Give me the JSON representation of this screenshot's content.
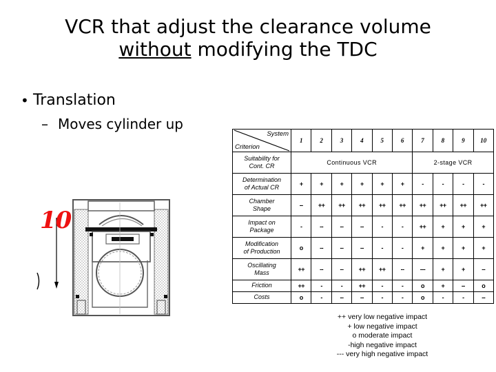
{
  "slide": {
    "title_line1": "VCR that adjust the clearance volume",
    "title_line2_underlined": "without",
    "title_line2_rest": " modifying the TDC"
  },
  "bullets": {
    "level1": "Translation",
    "level2": "Moves cylinder up"
  },
  "figure": {
    "label": "10",
    "caption_icon": "piston-cylinder-drawing"
  },
  "table": {
    "corner": {
      "top_right": "System",
      "bottom_left": "Criterion"
    },
    "columns": [
      "1",
      "2",
      "3",
      "4",
      "5",
      "6",
      "7",
      "8",
      "9",
      "10"
    ],
    "suitability": {
      "label_line1": "Suitability for",
      "label_line2": "Cont. CR",
      "groups": [
        {
          "name": "Continuous VCR",
          "span": 6
        },
        {
          "name": "2-stage VCR",
          "span": 4
        }
      ]
    },
    "rows": [
      {
        "label_line1": "Determination",
        "label_line2": "of Actual CR",
        "values": [
          "+",
          "+",
          "+",
          "+",
          "+",
          "+",
          "-",
          "-",
          "-",
          "-"
        ]
      },
      {
        "label_line1": "Chamber",
        "label_line2": "Shape",
        "values": [
          "--",
          "++",
          "++",
          "++",
          "++",
          "++",
          "++",
          "++",
          "++",
          "++"
        ]
      },
      {
        "label_line1": "Impact on",
        "label_line2": "Package",
        "values": [
          "-",
          "--",
          "--",
          "--",
          "-",
          "-",
          "++",
          "+",
          "+",
          "+"
        ]
      },
      {
        "label_line1": "Modification",
        "label_line2": "of Production",
        "values": [
          "o",
          "--",
          "--",
          "--",
          "-",
          "-",
          "+",
          "+",
          "+",
          "+"
        ]
      },
      {
        "label_line1": "Oscillating",
        "label_line2": "Mass",
        "values": [
          "++",
          "--",
          "--",
          "++",
          "++",
          "--",
          "---",
          "+",
          "+",
          "--"
        ]
      },
      {
        "label_line1": "Friction",
        "label_line2": "",
        "values": [
          "++",
          "-",
          "-",
          "++",
          "-",
          "-",
          "o",
          "+",
          "--",
          "o"
        ]
      },
      {
        "label_line1": "Costs",
        "label_line2": "",
        "values": [
          "o",
          "-",
          "--",
          "--",
          "-",
          "-",
          "o",
          "-",
          "-",
          "--"
        ]
      }
    ],
    "highlight_column_index": 9,
    "highlight_color": "#ffff00"
  },
  "legend": {
    "lines": [
      "++ very low negative impact",
      "+ low negative impact",
      "o moderate impact",
      "-high negative impact",
      "--- very high negative impact"
    ]
  },
  "colors": {
    "column_number": "#b00000",
    "figure_label": "#ee1111",
    "highlight": "#ffff00"
  }
}
